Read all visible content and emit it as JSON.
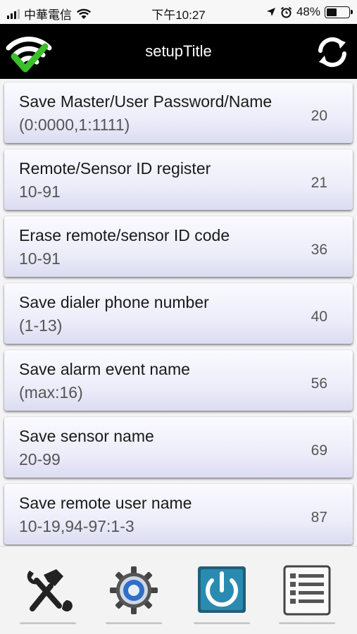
{
  "status_bar": {
    "carrier": "中華電信",
    "time": "下午10:27",
    "battery": "48%",
    "battery_level": 0.48,
    "icons": [
      "signal-icon",
      "wifi-icon",
      "location-arrow-icon",
      "alarm-icon",
      "battery-icon"
    ]
  },
  "nav": {
    "title": "setupTitle",
    "left_icon": "wifi-connected-icon",
    "right_icon": "refresh-icon"
  },
  "items": [
    {
      "title": "Save Master/User Password/Name",
      "subtitle": "(0:0000,1:1111)",
      "code": "20"
    },
    {
      "title": "Remote/Sensor ID register",
      "subtitle": "10-91",
      "code": "21"
    },
    {
      "title": "Erase remote/sensor ID code",
      "subtitle": "10-91",
      "code": "36"
    },
    {
      "title": "Save dialer phone number",
      "subtitle": "(1-13)",
      "code": "40"
    },
    {
      "title": "Save alarm event name",
      "subtitle": "(max:16)",
      "code": "56"
    },
    {
      "title": "Save sensor name",
      "subtitle": "20-99",
      "code": "69"
    },
    {
      "title": "Save remote user name",
      "subtitle": "10-19,94-97:1-3",
      "code": "87"
    }
  ],
  "tabs": [
    {
      "name": "tools-icon"
    },
    {
      "name": "settings-gear-icon"
    },
    {
      "name": "power-icon"
    },
    {
      "name": "list-icon"
    }
  ]
}
